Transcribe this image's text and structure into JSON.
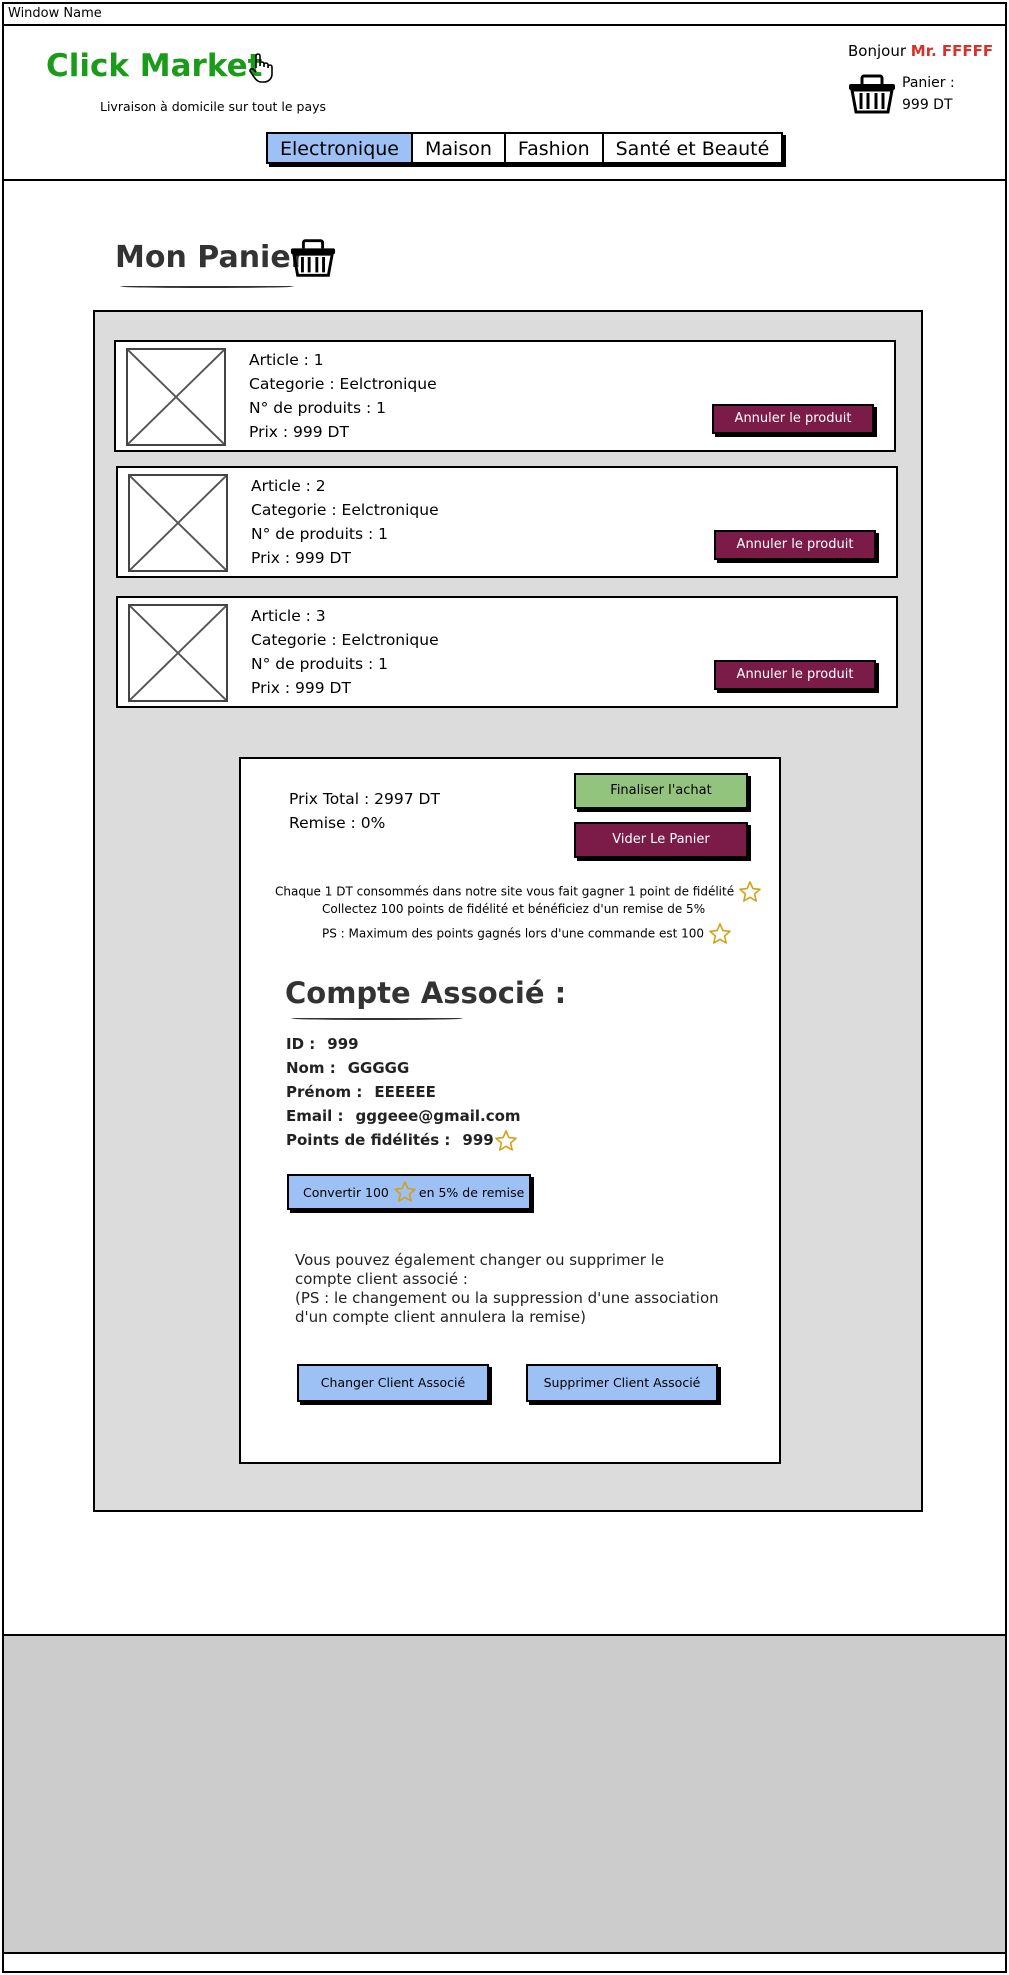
{
  "window": {
    "title": "Window Name"
  },
  "header": {
    "brand": "Click Market",
    "tagline": "Livraison à domicile sur tout le pays",
    "greeting_prefix": "Bonjour",
    "greeting_user": "Mr. FFFFF",
    "cart_label": "Panier :",
    "cart_total": "999 DT"
  },
  "nav": {
    "tabs": [
      {
        "label": "Electronique",
        "active": true
      },
      {
        "label": "Maison",
        "active": false
      },
      {
        "label": "Fashion",
        "active": false
      },
      {
        "label": "Santé et Beauté",
        "active": false
      }
    ]
  },
  "page": {
    "title": "Mon Panier"
  },
  "articles": [
    {
      "article": "Article : 1",
      "categorie": "Categorie : Eelctronique",
      "quantite": "N° de produits : 1",
      "prix": "Prix : 999 DT",
      "cancel_label": "Annuler le produit"
    },
    {
      "article": "Article : 2",
      "categorie": "Categorie : Eelctronique",
      "quantite": "N° de produits : 1",
      "prix": "Prix : 999 DT",
      "cancel_label": "Annuler le produit"
    },
    {
      "article": "Article : 3",
      "categorie": "Categorie : Eelctronique",
      "quantite": "N° de produits : 1",
      "prix": "Prix : 999 DT",
      "cancel_label": "Annuler le produit"
    }
  ],
  "summary": {
    "total": "Prix Total : 2997 DT",
    "remise": "Remise : 0%",
    "finish_label": "Finaliser l'achat",
    "empty_label": "Vider Le Panier",
    "loyalty_1": "Chaque 1 DT consommés dans notre site vous fait gagner 1 point de fidélité",
    "loyalty_2": "Collectez 100 points de fidélité et bénéficiez d'un remise de 5%",
    "loyalty_3": "PS : Maximum des points gagnés lors d'une commande est 100"
  },
  "account": {
    "title": "Compte Associé :",
    "id_label": "ID :",
    "id_value": "999",
    "nom_label": "Nom :",
    "nom_value": "GGGGG",
    "prenom_label": "Prénom :",
    "prenom_value": "EEEEEE",
    "email_label": "Email :",
    "email_value": "gggeee@gmail.com",
    "points_label": "Points de fidélités :",
    "points_value": "999",
    "convert_prefix": "Convertir 100",
    "convert_suffix": "en 5% de remise",
    "note_1": "Vous pouvez également changer ou supprimer le compte client associé :",
    "note_2": "(PS : le changement ou la suppression d'une association d'un compte client annulera la remise)",
    "change_label": "Changer Client Associé",
    "delete_label": "Supprimer Client Associé"
  },
  "colors": {
    "brand": "#1a9b1a",
    "user": "#d9302a",
    "active_tab": "#9ec1f5",
    "danger": "#7a1b48",
    "success": "#93c47d",
    "panel": "#dcdcdc",
    "star": "#d4a017"
  }
}
